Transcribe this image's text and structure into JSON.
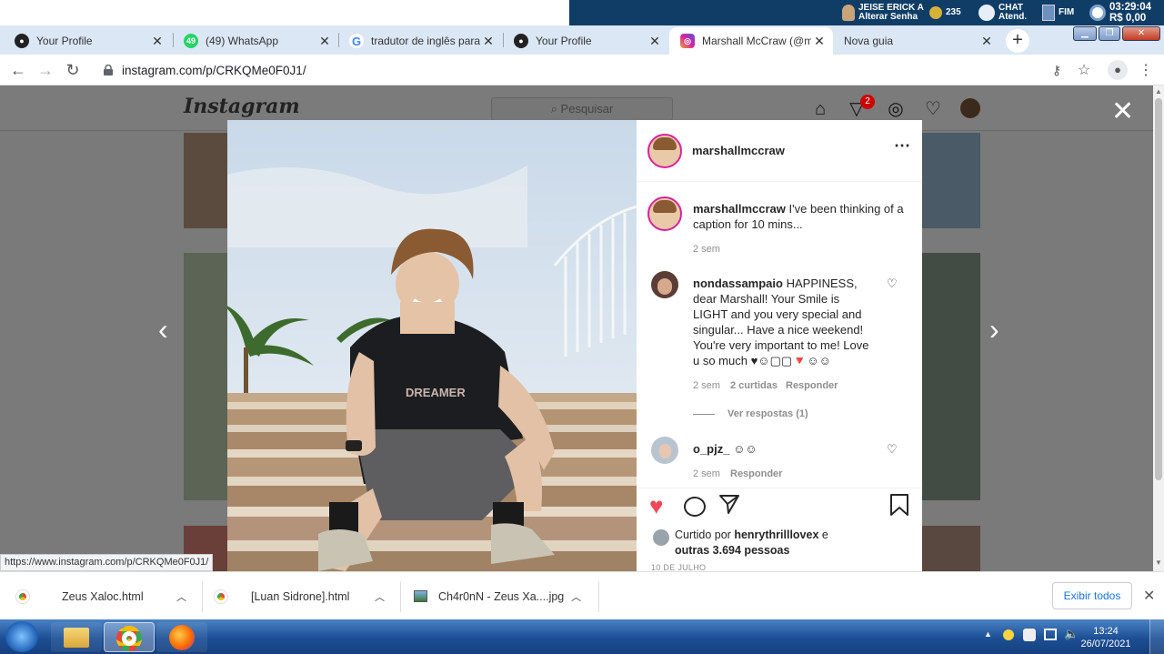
{
  "cafe": {
    "user_name": "JEISE ERICK A",
    "change_password": "Alterar Senha",
    "points": "235",
    "chat_label_1": "CHAT",
    "chat_label_2": "Atend.",
    "end_label": "FIM",
    "time_remaining": "03:29:04",
    "balance": "R$ 0,00"
  },
  "tabs": [
    {
      "title": "Your Profile",
      "favicon": "github-icon"
    },
    {
      "title": "(49) WhatsApp",
      "favicon": "whatsapp-icon"
    },
    {
      "title": "tradutor de inglês para p",
      "favicon": "google-icon"
    },
    {
      "title": "Your Profile",
      "favicon": "github-icon"
    },
    {
      "title": "Marshall McCraw (@mar",
      "favicon": "instagram-icon",
      "active": true
    },
    {
      "title": "Nova guia",
      "favicon": "none"
    }
  ],
  "address": {
    "url": "instagram.com/p/CRKQMe0F0J1/"
  },
  "instagram": {
    "logo": "Instagram",
    "search_placeholder": "Pesquisar",
    "notification_count": "2"
  },
  "post": {
    "author": "marshallmccraw",
    "caption_user": "marshallmccraw",
    "caption_text": "I've been thinking of a caption for 10 mins...",
    "caption_age": "2 sem",
    "comments": [
      {
        "user": "nondassampaio",
        "text": "HAPPINESS, dear Marshall! Your Smile is LIGHT and you very special and singular... Have a nice weekend! You're very important to me! Love u so much ♥☺▢▢🔻☺☺",
        "age": "2 sem",
        "likes": "2 curtidas",
        "reply": "Responder",
        "view_replies": "Ver respostas (1)"
      },
      {
        "user": "o_pjz_",
        "text": "☺☺",
        "age": "2 sem",
        "reply": "Responder"
      }
    ],
    "liked_by_prefix": "Curtido por",
    "liked_by_user": "henrythrilllovex",
    "liked_by_suffix": "e",
    "liked_by_others": "outras 3.694 pessoas",
    "date": "10 DE JULHO",
    "shirt_text": "DREAMER"
  },
  "status_url": "https://www.instagram.com/p/CRKQMe0F0J1/",
  "downloads": [
    {
      "name": "Zeus Xaloc.html",
      "icon": "chrome-icon"
    },
    {
      "name": "[Luan Sidrone].html",
      "icon": "chrome-icon"
    },
    {
      "name": "Ch4r0nN - Zeus Xa....jpg",
      "icon": "image-file-icon"
    }
  ],
  "download_show_all": "Exibir todos",
  "taskbar": {
    "time": "13:24",
    "date": "26/07/2021"
  }
}
